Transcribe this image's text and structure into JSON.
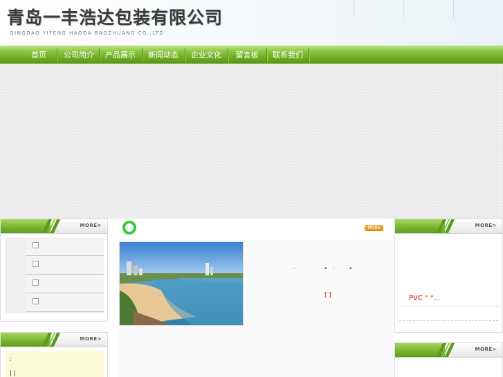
{
  "header": {
    "title_cn": "青岛一丰浩达包装有限公司",
    "title_en": "QINGDAO YIFENG HAODA BAOZHUANG CO.,LTD"
  },
  "nav": {
    "items": [
      {
        "label": "首页"
      },
      {
        "label": "公司简介"
      },
      {
        "label": "产品展示"
      },
      {
        "label": "新闻动态"
      },
      {
        "label": "企业文化"
      },
      {
        "label": "留言板"
      },
      {
        "label": "联系我们"
      }
    ]
  },
  "left_box": {
    "more": "MORE>"
  },
  "contact_box": {
    "more": "MORE>",
    "line1": ":",
    "line2": "| |"
  },
  "center_box": {
    "more": "MORE",
    "marks": [
      "··",
      "•",
      "·",
      "•"
    ],
    "bracket": "[ ]"
  },
  "right_box": {
    "more": "MORE>",
    "item1": "PVC  \" \"..."
  },
  "right_box2": {
    "more": "MORE>"
  },
  "colors": {
    "nav_green": "#6aa820",
    "accent_orange": "#e08a1c",
    "link_red": "#cc0000",
    "circle_green": "#33cc33"
  }
}
